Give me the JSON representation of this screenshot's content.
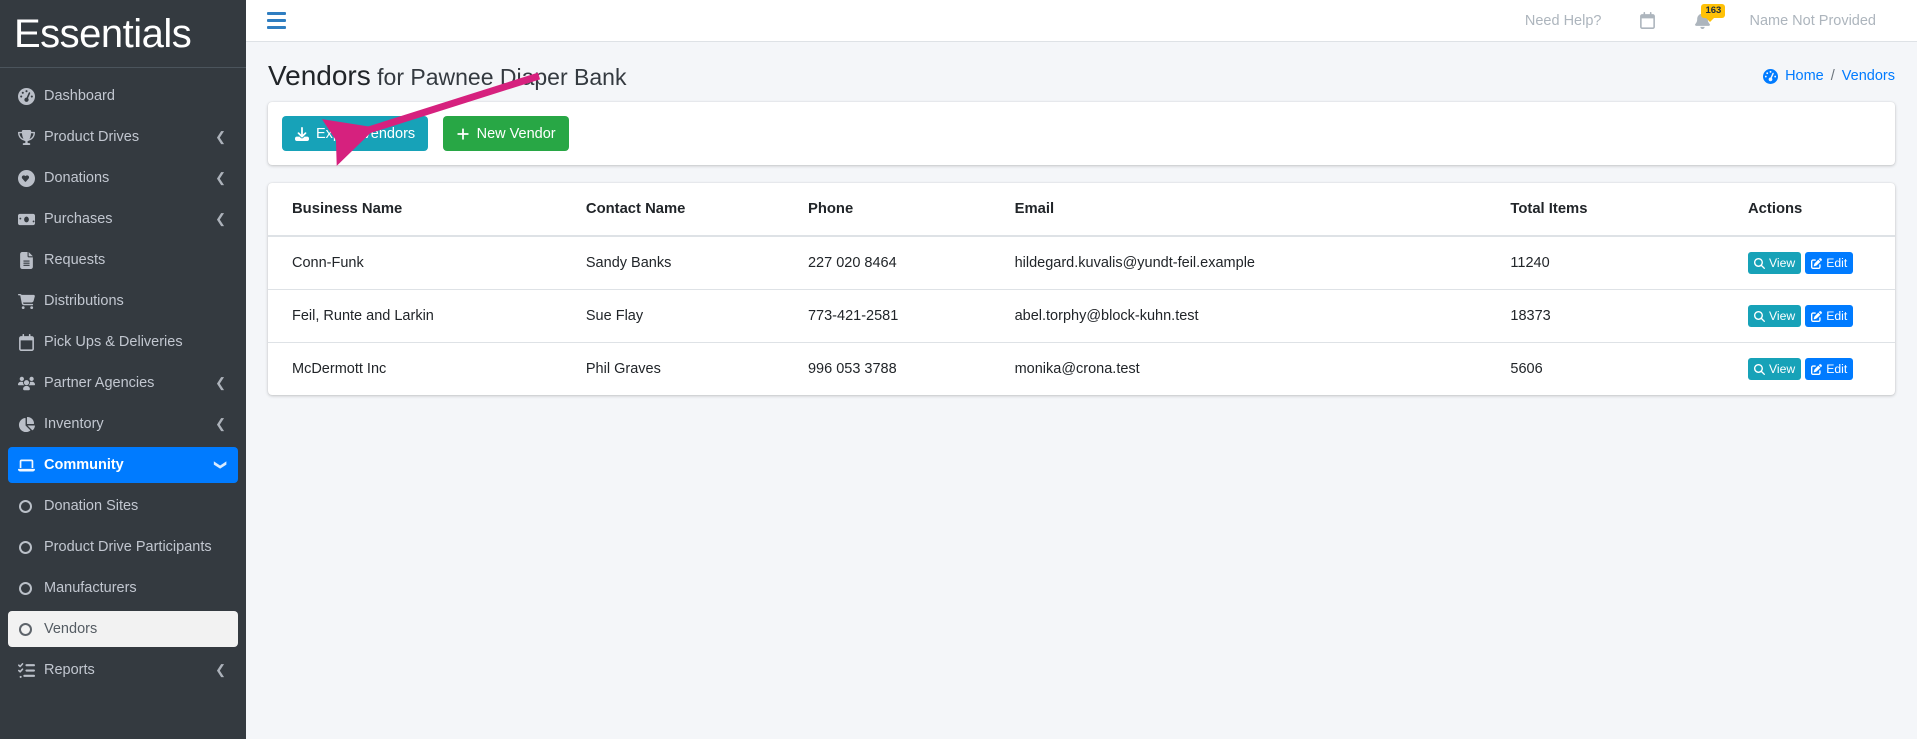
{
  "brand": {
    "name": "Essentials"
  },
  "sidebar": {
    "items": [
      {
        "label": "Dashboard",
        "icon": "dashboard-icon",
        "type": "main",
        "state": "normal",
        "chevron": ""
      },
      {
        "label": "Product Drives",
        "icon": "trophy-icon",
        "type": "main",
        "state": "normal",
        "chevron": "left"
      },
      {
        "label": "Donations",
        "icon": "heart-circle-icon",
        "type": "main",
        "state": "normal",
        "chevron": "left"
      },
      {
        "label": "Purchases",
        "icon": "money-bill-icon",
        "type": "main",
        "state": "normal",
        "chevron": "left"
      },
      {
        "label": "Requests",
        "icon": "file-lines-icon",
        "type": "main",
        "state": "normal",
        "chevron": ""
      },
      {
        "label": "Distributions",
        "icon": "cart-icon",
        "type": "main",
        "state": "normal",
        "chevron": ""
      },
      {
        "label": "Pick Ups & Deliveries",
        "icon": "calendar-icon",
        "type": "main",
        "state": "normal",
        "chevron": ""
      },
      {
        "label": "Partner Agencies",
        "icon": "users-icon",
        "type": "main",
        "state": "normal",
        "chevron": "left"
      },
      {
        "label": "Inventory",
        "icon": "chart-pie-icon",
        "type": "main",
        "state": "normal",
        "chevron": "left"
      },
      {
        "label": "Community",
        "icon": "laptop-icon",
        "type": "main",
        "state": "active-blue",
        "chevron": "down"
      },
      {
        "label": "Donation Sites",
        "icon": "circle-icon",
        "type": "sub",
        "state": "normal",
        "chevron": ""
      },
      {
        "label": "Product Drive Participants",
        "icon": "circle-icon",
        "type": "sub",
        "state": "normal",
        "chevron": ""
      },
      {
        "label": "Manufacturers",
        "icon": "circle-icon",
        "type": "sub",
        "state": "normal",
        "chevron": ""
      },
      {
        "label": "Vendors",
        "icon": "circle-icon",
        "type": "sub",
        "state": "active-light",
        "chevron": ""
      },
      {
        "label": "Reports",
        "icon": "list-check-icon",
        "type": "main",
        "state": "normal",
        "chevron": "left"
      }
    ]
  },
  "topbar": {
    "menu_toggle": "hamburger-icon",
    "need_help": "Need Help?",
    "calendar_icon": "calendar-icon",
    "notifications_icon": "bell-icon",
    "notifications_count": "163",
    "user_name": "Name Not Provided"
  },
  "page": {
    "title_main": "Vendors",
    "title_suffix": " for Pawnee Diaper Bank",
    "breadcrumb": {
      "home_icon": "dashboard-icon",
      "home": "Home",
      "separator": "/",
      "current": "Vendors"
    }
  },
  "toolbar": {
    "export_label": "Export Vendors",
    "export_icon": "download-icon",
    "new_label": "New Vendor",
    "new_icon": "plus-icon"
  },
  "table": {
    "columns": [
      "Business Name",
      "Contact Name",
      "Phone",
      "Email",
      "Total Items",
      "Actions"
    ],
    "rows": [
      {
        "business": "Conn-Funk",
        "contact": "Sandy Banks",
        "phone": "227 020 8464",
        "email": "hildegard.kuvalis@yundt-feil.example",
        "total_items": "11240",
        "view": "View",
        "edit": "Edit"
      },
      {
        "business": "Feil, Runte and Larkin",
        "contact": "Sue Flay",
        "phone": "773-421-2581",
        "email": "abel.torphy@block-kuhn.test",
        "total_items": "18373",
        "view": "View",
        "edit": "Edit"
      },
      {
        "business": "McDermott Inc",
        "contact": "Phil Graves",
        "phone": "996 053 3788",
        "email": "monika@crona.test",
        "total_items": "5606",
        "view": "View",
        "edit": "Edit"
      }
    ]
  },
  "annotation": {
    "arrow_color": "#d6217e",
    "points_to": "Export Vendors"
  },
  "colors": {
    "sidebar_bg": "#343a40",
    "accent_blue": "#007bff",
    "teal": "#17a2b8",
    "green": "#28a745",
    "badge_yellow": "#ffc107"
  }
}
